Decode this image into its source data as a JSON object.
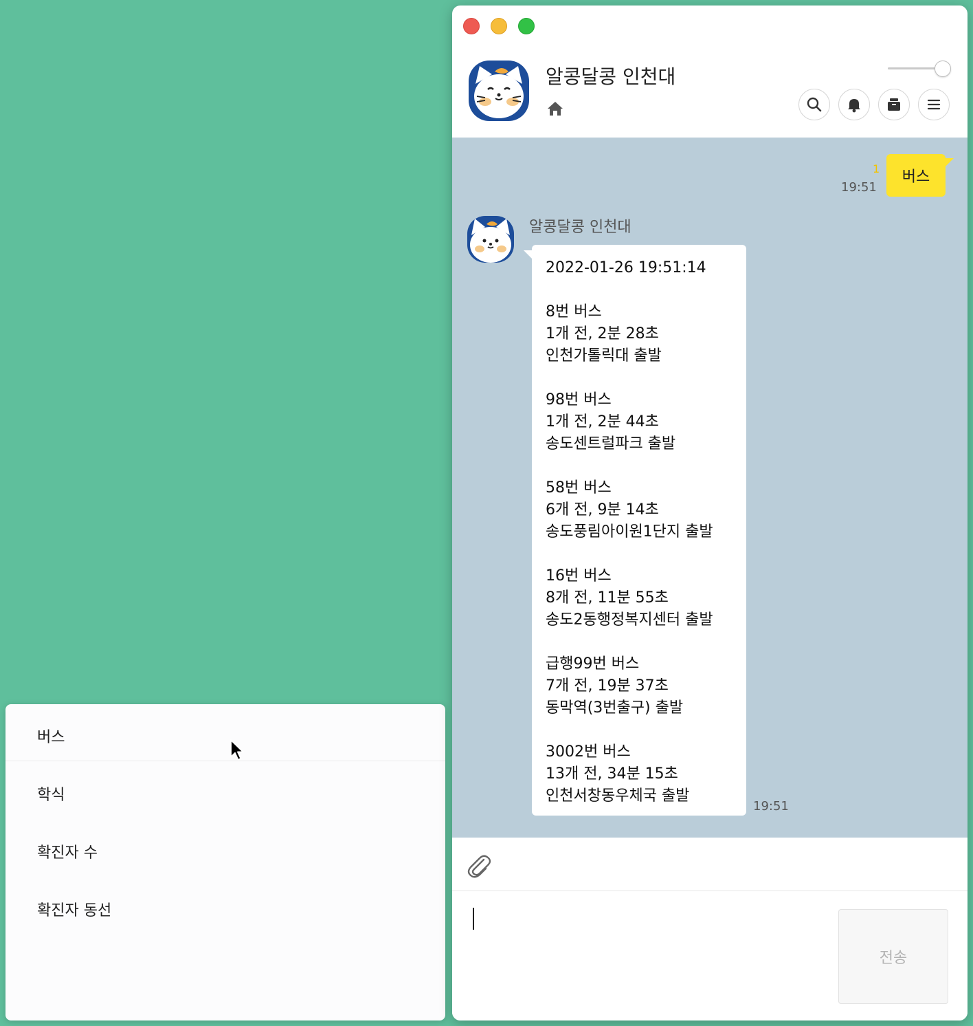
{
  "quick_replies": {
    "items": [
      "버스",
      "학식",
      "확진자 수",
      "확진자 동선"
    ]
  },
  "chat_window": {
    "title": "알콩달콩 인천대",
    "icons": {
      "home": "home-icon",
      "search": "search-icon",
      "notifications": "bell-icon",
      "drawer": "drawer-icon",
      "menu": "menu-icon",
      "attach": "paperclip-icon"
    },
    "opacity_slider_value": 1.0
  },
  "messages": {
    "sent": {
      "text": "버스",
      "unread": "1",
      "time": "19:51"
    },
    "received": {
      "sender": "알콩달콩 인천대",
      "time": "19:51",
      "timestamp": "2022-01-26 19:51:14",
      "buses": [
        {
          "route": "8번 버스",
          "eta": "1개 전, 2분 28초",
          "location": "인천가톨릭대 출발"
        },
        {
          "route": "98번 버스",
          "eta": "1개 전, 2분 44초",
          "location": "송도센트럴파크 출발"
        },
        {
          "route": "58번 버스",
          "eta": "6개 전, 9분 14초",
          "location": "송도풍림아이원1단지 출발"
        },
        {
          "route": "16번 버스",
          "eta": "8개 전, 11분 55초",
          "location": "송도2동행정복지센터 출발"
        },
        {
          "route": "급행99번 버스",
          "eta": "7개 전, 19분 37초",
          "location": "동막역(3번출구) 출발"
        },
        {
          "route": "3002번 버스",
          "eta": "13개 전, 34분 15초",
          "location": "인천서창동우체국 출발"
        }
      ]
    }
  },
  "composer": {
    "send_label": "전송"
  },
  "colors": {
    "desktop": "#5fbf9c",
    "chat_background": "#bacdd9",
    "my_bubble": "#fde32c",
    "unread": "#f2c300"
  }
}
